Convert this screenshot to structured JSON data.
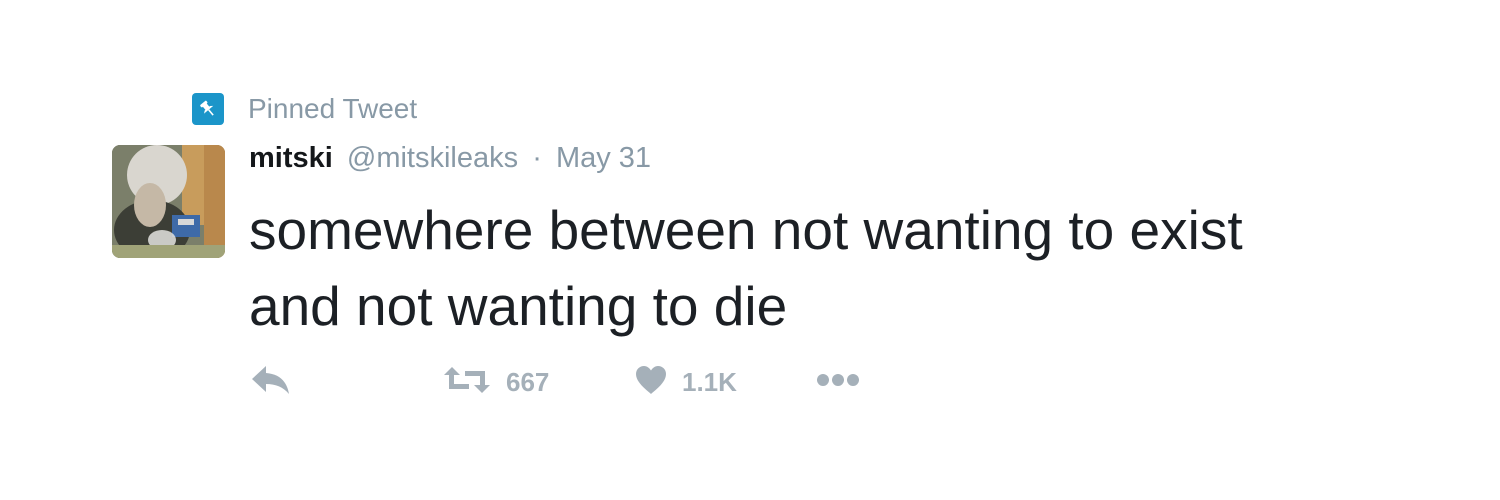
{
  "pinned": {
    "label": "Pinned Tweet",
    "icon": "pin-icon",
    "badge_color": "#1b95c9"
  },
  "author": {
    "name": "mitski",
    "handle": "@mitskileaks",
    "separator": "·",
    "date": "May 31"
  },
  "tweet": {
    "lines": [
      "somewhere between not wanting to exist",
      "and not wanting to die"
    ]
  },
  "actions": {
    "reply": {
      "icon": "reply-icon"
    },
    "retweet": {
      "icon": "retweet-icon",
      "count": "667"
    },
    "like": {
      "icon": "heart-icon",
      "count": "1.1K"
    },
    "more": {
      "icon": "more-icon"
    }
  },
  "colors": {
    "muted": "#8899a6",
    "text": "#1c2025",
    "action_gray": "#a5b0b9"
  }
}
